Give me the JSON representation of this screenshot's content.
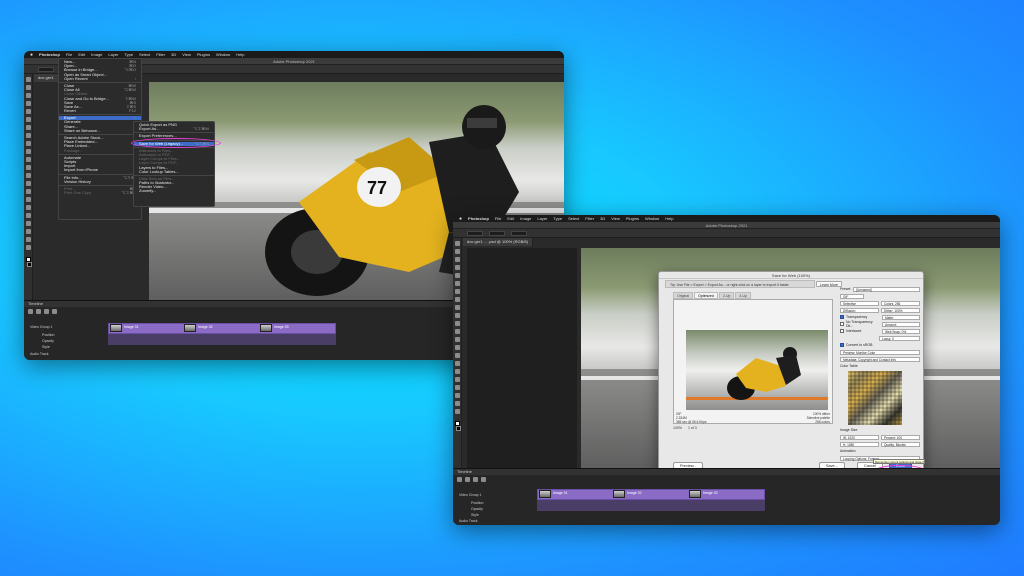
{
  "mac_menu": {
    "apple": "",
    "app": "Photoshop",
    "items": [
      "File",
      "Edit",
      "Image",
      "Layer",
      "Type",
      "Select",
      "Filter",
      "3D",
      "View",
      "Plugins",
      "Window",
      "Help"
    ]
  },
  "window1": {
    "title": "Adobe Photoshop 2021",
    "doc_tab": "doc ger1",
    "status": "Timeline",
    "file_menu": [
      {
        "label": "New...",
        "sc": "⌘N"
      },
      {
        "label": "Open...",
        "sc": "⌘O"
      },
      {
        "label": "Browse in Bridge...",
        "sc": "⌥⌘O"
      },
      {
        "label": "Open as Smart Object...",
        "sc": ""
      },
      {
        "label": "Open Recent",
        "sc": "›"
      },
      {
        "sep": true
      },
      {
        "label": "Close",
        "sc": "⌘W"
      },
      {
        "label": "Close All",
        "sc": "⌥⌘W"
      },
      {
        "label": "Close Others",
        "sc": "",
        "dim": true
      },
      {
        "label": "Close and Go to Bridge...",
        "sc": "⇧⌘W"
      },
      {
        "label": "Save",
        "sc": "⌘S"
      },
      {
        "label": "Save As...",
        "sc": "⇧⌘S"
      },
      {
        "label": "Revert",
        "sc": "F12"
      },
      {
        "sep": true
      },
      {
        "label": "Export",
        "sc": "›",
        "hl": true
      },
      {
        "label": "Generate",
        "sc": "›"
      },
      {
        "label": "Share...",
        "sc": ""
      },
      {
        "label": "Share on Behance...",
        "sc": ""
      },
      {
        "sep": true
      },
      {
        "label": "Search Adobe Stock...",
        "sc": ""
      },
      {
        "label": "Place Embedded...",
        "sc": ""
      },
      {
        "label": "Place Linked...",
        "sc": ""
      },
      {
        "label": "Package...",
        "sc": "",
        "dim": true
      },
      {
        "sep": true
      },
      {
        "label": "Automate",
        "sc": "›"
      },
      {
        "label": "Scripts",
        "sc": "›"
      },
      {
        "label": "Import",
        "sc": "›"
      },
      {
        "label": "Import from iPhone",
        "sc": "›"
      },
      {
        "sep": true
      },
      {
        "label": "File Info...",
        "sc": "⌥⇧⌘I"
      },
      {
        "label": "Version History",
        "sc": ""
      },
      {
        "sep": true
      },
      {
        "label": "Print...",
        "sc": "⌘P",
        "dim": true
      },
      {
        "label": "Print One Copy",
        "sc": "⌥⇧⌘P",
        "dim": true
      }
    ],
    "export_menu": [
      {
        "label": "Quick Export as PNG",
        "sc": ""
      },
      {
        "label": "Export As...",
        "sc": "⌥⇧⌘W"
      },
      {
        "sep": true
      },
      {
        "label": "Export Preferences...",
        "sc": ""
      },
      {
        "sep": true
      },
      {
        "label": "Save for Web (Legacy)...",
        "sc": "⌥⇧⌘S",
        "hl": true
      },
      {
        "sep": true
      },
      {
        "label": "Artboards to Files...",
        "sc": "",
        "dim": true
      },
      {
        "label": "Artboards to PDF...",
        "sc": "",
        "dim": true
      },
      {
        "label": "Layer Comps to Files...",
        "sc": "",
        "dim": true
      },
      {
        "label": "Layer Comps to PDF...",
        "sc": "",
        "dim": true
      },
      {
        "label": "Layers to Files...",
        "sc": ""
      },
      {
        "label": "Color Lookup Tables...",
        "sc": ""
      },
      {
        "sep": true
      },
      {
        "label": "Data Sets as Files...",
        "sc": "",
        "dim": true
      },
      {
        "label": "Paths to Illustrator...",
        "sc": ""
      },
      {
        "label": "Render Video...",
        "sc": ""
      },
      {
        "label": "Zoomify...",
        "sc": ""
      }
    ],
    "timeline_layers": [
      "Video Group 1",
      "Position",
      "Opacity",
      "Style"
    ],
    "clips": [
      "Image 01",
      "Image 02",
      "Image 03"
    ],
    "footer": "Audio Track"
  },
  "window2": {
    "title": "Adobe Photoshop 2021",
    "doc_tab": "doc ger1 ... .psd @ 100% (RGB/8)",
    "dialog": {
      "title": "Save for Web (100%)",
      "info": "Tip: Use File > Export > Export As... or right-click on a layer to export it faster.",
      "learn": "Learn More",
      "tabs": [
        "Original",
        "Optimized",
        "2-Up",
        "4-Up"
      ],
      "active_tab": 1,
      "meta_left": [
        "GIF",
        "2.334M",
        "365 sec @ 56.6 Kbps"
      ],
      "meta_right": [
        "100% dither",
        "Selective palette",
        "256 colors"
      ],
      "preset_label": "Preset:",
      "preset_value": "[Unnamed]",
      "format": "GIF",
      "rows": [
        {
          "label": "Selective",
          "value": "Colors: 256"
        },
        {
          "label": "Diffusion",
          "value": "Dither: 100%"
        },
        {
          "label": "Transparency",
          "value": "Matte:"
        },
        {
          "label": "No Transparency Dit...",
          "value": "Amount:"
        },
        {
          "label": "Interlaced",
          "value": "Web Snap: 0%"
        },
        {
          "label": "",
          "value": "Lossy: 0"
        }
      ],
      "convert_srgb": "Convert to sRGB",
      "preview": "Preview: Monitor Color",
      "metadata": "Metadata: Copyright and Contact Info",
      "color_table_label": "Color Table",
      "image_size_label": "Image Size",
      "image_w": "W: 1920",
      "image_h": "H: 1080",
      "percent": "Percent: 100",
      "quality": "Quality: Bicubic",
      "animation_label": "Animation",
      "looping": "Looping Options: Forever",
      "frame_counter": "1 of 3",
      "zoom": "100%",
      "buttons": {
        "preview": "Preview...",
        "save": "Save...",
        "cancel": "Cancel",
        "done": "Done"
      },
      "tooltip": "Remember current settings and close the dialog"
    },
    "timeline_layers": [
      "Video Group 1",
      "Position",
      "Opacity",
      "Style"
    ],
    "clips": [
      "Image 01",
      "Image 02",
      "Image 03"
    ],
    "footer": "Audio Track"
  },
  "colors": {
    "highlight": "#e83fd8",
    "menu_hl": "#3d6cc8",
    "timeline_clip": "#8a6cc7"
  }
}
